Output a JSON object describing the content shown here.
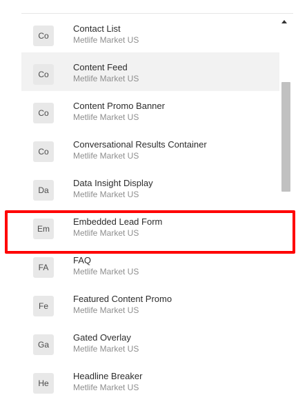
{
  "components": [
    {
      "abbr": "Co",
      "name": "Contact List",
      "site": "Metlife Market US"
    },
    {
      "abbr": "Co",
      "name": "Content Feed",
      "site": "Metlife Market US"
    },
    {
      "abbr": "Co",
      "name": "Content Promo Banner",
      "site": "Metlife Market US"
    },
    {
      "abbr": "Co",
      "name": "Conversational Results Container",
      "site": "Metlife Market US"
    },
    {
      "abbr": "Da",
      "name": "Data Insight Display",
      "site": "Metlife Market US"
    },
    {
      "abbr": "Em",
      "name": "Embedded Lead Form",
      "site": "Metlife Market US"
    },
    {
      "abbr": "FA",
      "name": "FAQ",
      "site": "Metlife Market US"
    },
    {
      "abbr": "Fe",
      "name": "Featured Content Promo",
      "site": "Metlife Market US"
    },
    {
      "abbr": "Ga",
      "name": "Gated Overlay",
      "site": "Metlife Market US"
    },
    {
      "abbr": "He",
      "name": "Headline Breaker",
      "site": "Metlife Market US"
    }
  ],
  "colors": {
    "highlight": "#ff0000",
    "hover_row": "#f2f2f2",
    "badge_bg": "#e8e8e8"
  }
}
